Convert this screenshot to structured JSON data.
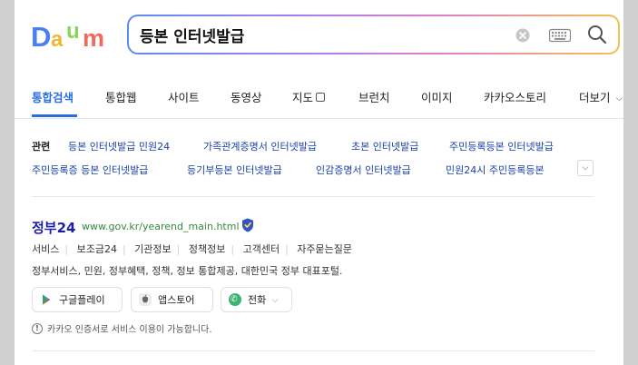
{
  "header": {
    "logo_text": "Daum",
    "search": {
      "value": "등본 인터넷발급",
      "placeholder": ""
    }
  },
  "tabs": [
    {
      "label": "통합검색",
      "active": true
    },
    {
      "label": "통합웹"
    },
    {
      "label": "사이트"
    },
    {
      "label": "동영상"
    },
    {
      "label": "지도"
    },
    {
      "label": "브런치"
    },
    {
      "label": "이미지"
    },
    {
      "label": "카카오스토리"
    },
    {
      "label": "더보기"
    }
  ],
  "related": {
    "title": "관련",
    "row1": [
      "등본 인터넷발급 민원24",
      "가족관계증명서 인터넷발급",
      "초본 인터넷발급",
      "주민등록등본 인터넷발급"
    ],
    "row2": [
      "주민등록증 등본 인터넷발급",
      "등기부등본 인터넷발급",
      "인감증명서 인터넷발급",
      "민원24시 주민등록등본"
    ]
  },
  "result": {
    "title": "정부24",
    "url": "www.gov.kr/yearend_main.html",
    "sublinks": [
      "서비스",
      "보조금24",
      "기관정보",
      "정책정보",
      "고객센터",
      "자주묻는질문"
    ],
    "description": "정부서비스, 민원, 정부혜택, 정책, 정보 통합제공, 대한민국 정부 대표포털.",
    "buttons": {
      "google_play": "구글플레이",
      "app_store": "앱스토어",
      "phone": "전화"
    },
    "notice": "카카오 인증서로 서비스 이용이 가능합니다."
  },
  "colors": {
    "accent": "#2a6ede",
    "link": "#1a3fa6",
    "title": "#1b1fa8",
    "url": "#338a3e"
  }
}
